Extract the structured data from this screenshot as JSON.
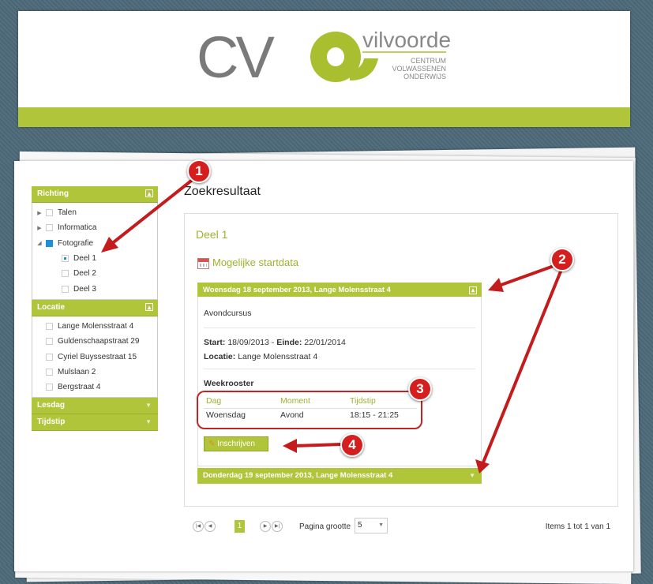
{
  "header": {
    "logo_main": "CV",
    "logo_city": "vilvoorde",
    "logo_sub": [
      "CENTRUM",
      "VOLWASSENEN",
      "ONDERWIJS"
    ]
  },
  "colors": {
    "accent": "#b1c53b",
    "annotation": "#d51f1f",
    "checkbox": "#1e90d6"
  },
  "sidebar": {
    "richting": {
      "title": "Richting",
      "items": [
        {
          "label": "Talen",
          "level": 0,
          "expander": "▶",
          "check": ""
        },
        {
          "label": "Informatica",
          "level": 0,
          "expander": "▶",
          "check": ""
        },
        {
          "label": "Fotografie",
          "level": 0,
          "expander": "◢",
          "check": "full"
        },
        {
          "label": "Deel 1",
          "level": 1,
          "expander": "",
          "check": "partial"
        },
        {
          "label": "Deel 2",
          "level": 1,
          "expander": "",
          "check": ""
        },
        {
          "label": "Deel 3",
          "level": 1,
          "expander": "",
          "check": ""
        }
      ]
    },
    "locatie": {
      "title": "Locatie",
      "items": [
        {
          "label": "Lange Molensstraat 4"
        },
        {
          "label": "Guldenschaapstraat 29"
        },
        {
          "label": "Cyriel Buyssestraat 15"
        },
        {
          "label": "Mulslaan 2"
        },
        {
          "label": "Bergstraat 4"
        }
      ]
    },
    "lesdag": {
      "title": "Lesdag"
    },
    "tijdstip": {
      "title": "Tijdstip"
    }
  },
  "main": {
    "page_title": "Zoekresultaat",
    "deel_title": "Deel 1",
    "startdata_label": "Mogelijke startdata",
    "session1": {
      "header": "Woensdag 18 september 2013, Lange Molensstraat 4",
      "type": "Avondcursus",
      "start_label": "Start:",
      "start_value": "18/09/2013",
      "end_label": "Einde:",
      "end_value": "22/01/2014",
      "loc_label": "Locatie:",
      "loc_value": "Lange Molensstraat 4",
      "schedule_title": "Weekrooster",
      "schedule_headers": [
        "Dag",
        "Moment",
        "Tijdstip"
      ],
      "schedule_row": [
        "Woensdag",
        "Avond",
        "18:15 - 21:25"
      ],
      "button_label": "Inschrijven"
    },
    "session2": {
      "header": "Donderdag 19 september 2013, Lange Molensstraat 4"
    }
  },
  "pager": {
    "current_page": "1",
    "page_size_label": "Pagina grootte",
    "page_size_value": "5",
    "items_text": "Items 1 tot 1 van 1"
  },
  "annotations": [
    "1",
    "2",
    "3",
    "4"
  ]
}
